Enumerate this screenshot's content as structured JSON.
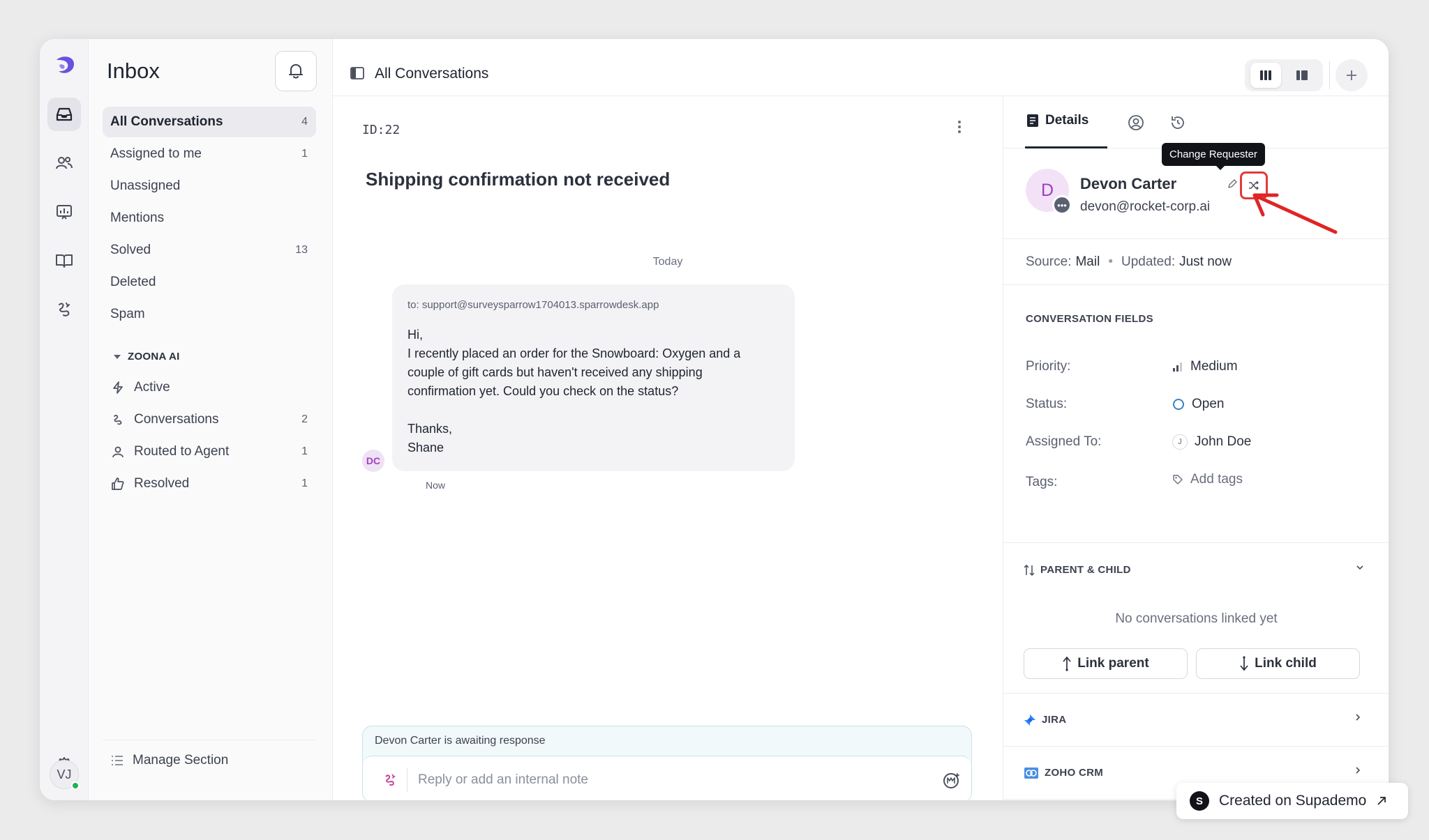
{
  "inbox": {
    "title": "Inbox",
    "items": [
      {
        "label": "All Conversations",
        "count": "4"
      },
      {
        "label": "Assigned to me",
        "count": "1"
      },
      {
        "label": "Unassigned",
        "count": ""
      },
      {
        "label": "Mentions",
        "count": ""
      },
      {
        "label": "Solved",
        "count": "13"
      },
      {
        "label": "Deleted",
        "count": ""
      },
      {
        "label": "Spam",
        "count": ""
      }
    ],
    "group": {
      "title": "ZOONA AI",
      "items": [
        {
          "label": "Active",
          "count": "",
          "icon": "bolt-icon"
        },
        {
          "label": "Conversations",
          "count": "2",
          "icon": "zoona-icon"
        },
        {
          "label": "Routed to Agent",
          "count": "1",
          "icon": "agent-icon"
        },
        {
          "label": "Resolved",
          "count": "1",
          "icon": "thumbs-up-icon"
        }
      ]
    },
    "manage": "Manage Section"
  },
  "user": {
    "initials": "VJ"
  },
  "header": {
    "title": "All Conversations"
  },
  "conversation": {
    "id": "ID:22",
    "subject": "Shipping confirmation not received",
    "day": "Today",
    "message": {
      "to": "to: support@surveysparrow1704013.sparrowdesk.app",
      "lines": [
        "Hi,",
        "I recently placed an order for the Snowboard: Oxygen and a",
        "couple of gift cards but haven't received any shipping",
        "confirmation yet. Could you check on the status?",
        "",
        "Thanks,",
        "Shane"
      ],
      "sender_initials": "DC",
      "time": "Now"
    },
    "awaiting": "Devon Carter is awaiting response",
    "reply_placeholder": "Reply or add an internal note"
  },
  "details": {
    "tab": "Details",
    "tooltip": "Change Requester",
    "requester": {
      "initial": "D",
      "name": "Devon Carter",
      "email": "devon@rocket-corp.ai"
    },
    "source_label": "Source:",
    "source": "Mail",
    "updated_label": "Updated:",
    "updated": "Just now",
    "fields_title": "CONVERSATION FIELDS",
    "fields": [
      {
        "label": "Priority:",
        "value": "Medium"
      },
      {
        "label": "Status:",
        "value": "Open"
      },
      {
        "label": "Assigned To:",
        "value": "John Doe",
        "avatar": "J"
      },
      {
        "label": "Tags:",
        "value": "Add tags"
      }
    ],
    "parent_child": {
      "title": "PARENT & CHILD",
      "empty": "No conversations linked yet",
      "link_parent": "Link parent",
      "link_child": "Link child"
    },
    "integrations": [
      {
        "name": "JIRA"
      },
      {
        "name": "ZOHO CRM"
      }
    ]
  },
  "badge": {
    "label": "Created on Supademo",
    "initial": "S"
  },
  "colors": {
    "accent": "#6b4fe0",
    "highlight": "#e23a3a",
    "status_open": "#3b82c4"
  }
}
